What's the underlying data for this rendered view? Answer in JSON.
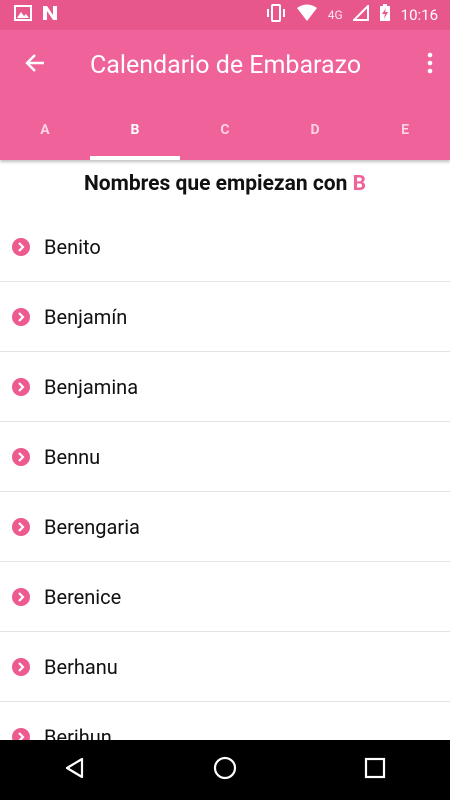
{
  "status_bar": {
    "time": "10:16",
    "network": "4G",
    "icons": [
      "image-icon",
      "n-app-icon",
      "vibrate-icon",
      "wifi-icon",
      "signal-icon",
      "battery-charging-icon"
    ]
  },
  "app_bar": {
    "title": "Calendario de Embarazo",
    "back_icon": "arrow-back-icon",
    "menu_icon": "more-vert-icon"
  },
  "tabs": [
    {
      "label": "A",
      "active": false
    },
    {
      "label": "B",
      "active": true
    },
    {
      "label": "C",
      "active": false
    },
    {
      "label": "D",
      "active": false
    },
    {
      "label": "E",
      "active": false
    }
  ],
  "heading": {
    "text": "Nombres que empiezan con ",
    "letter": "B"
  },
  "names": [
    "Benito",
    "Benjamín",
    "Benjamina",
    "Bennu",
    "Berengaria",
    "Berenice",
    "Berhanu",
    "Berihun"
  ],
  "nav_bar": {
    "buttons": [
      "back-triangle-icon",
      "home-circle-icon",
      "recents-square-icon"
    ]
  },
  "colors": {
    "accent": "#f0639a",
    "status_bar": "#e8578b",
    "chevron": "#ec5a90"
  }
}
